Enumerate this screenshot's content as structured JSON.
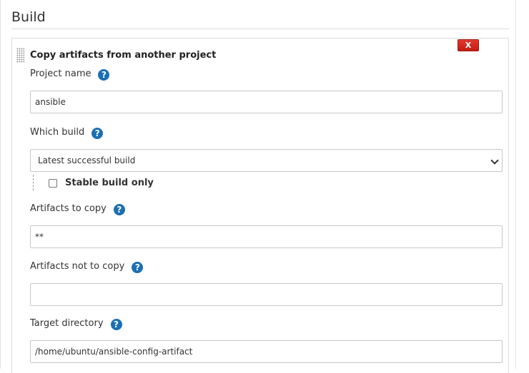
{
  "section": {
    "title": "Build"
  },
  "step": {
    "title": "Copy artifacts from another project",
    "delete_label": "X",
    "help_glyph": "?",
    "project_name": {
      "label": "Project name",
      "value": "ansible"
    },
    "which_build": {
      "label": "Which build",
      "selected": "Latest successful build",
      "stable_only_label": "Stable build only",
      "stable_only_checked": false
    },
    "artifacts_to_copy": {
      "label": "Artifacts to copy",
      "value": "**"
    },
    "artifacts_not_to_copy": {
      "label": "Artifacts not to copy",
      "value": ""
    },
    "target_directory": {
      "label": "Target directory",
      "value": "/home/ubuntu/ansible-config-artifact"
    }
  },
  "colors": {
    "help": "#1b6fb3",
    "delete": "#d12b20"
  },
  "icons": {
    "help": "help-icon",
    "delete": "close-icon",
    "drag": "drag-handle-icon",
    "select": "chevron-down-icon"
  }
}
